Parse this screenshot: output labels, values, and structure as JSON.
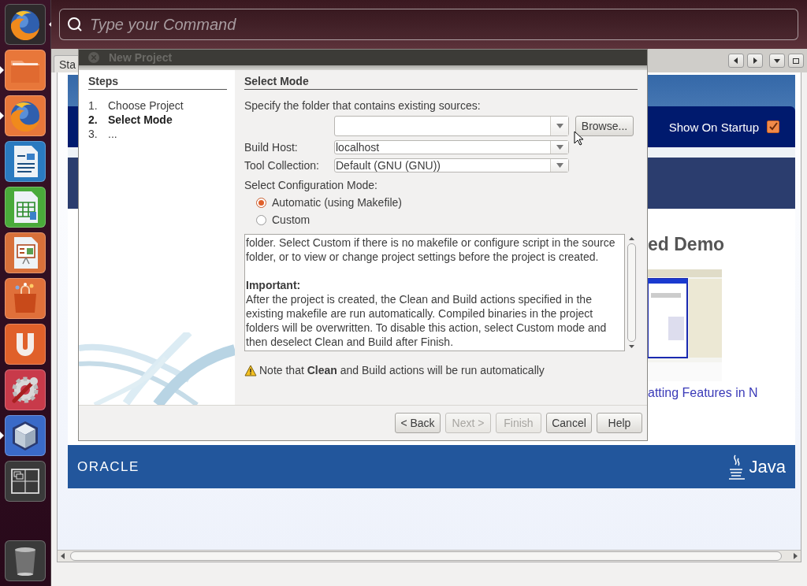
{
  "launcher": {
    "items": [
      {
        "kind": "firefox",
        "running": false,
        "selected": true
      },
      {
        "kind": "folder",
        "running": true,
        "selected": false
      },
      {
        "kind": "firefox",
        "running": true,
        "selected": false
      },
      {
        "kind": "writer",
        "running": false,
        "selected": false
      },
      {
        "kind": "calc",
        "running": false,
        "selected": false
      },
      {
        "kind": "impress",
        "running": false,
        "selected": false
      },
      {
        "kind": "store",
        "running": false,
        "selected": false
      },
      {
        "kind": "ubuntu_one",
        "running": false,
        "selected": false
      },
      {
        "kind": "settings",
        "running": false,
        "selected": false
      },
      {
        "kind": "cube",
        "running": true,
        "selected": false
      },
      {
        "kind": "workspaces",
        "running": false,
        "selected": false
      },
      {
        "kind": "trash",
        "running": false,
        "selected": false
      }
    ]
  },
  "dash": {
    "placeholder": "Type your Command"
  },
  "ide": {
    "tab": "Sta",
    "page": {
      "show_on_startup": {
        "label": "Show On Startup",
        "checked": true
      },
      "heading": "ed Demo",
      "link": "atting Features in N",
      "footer_left": "ORACLE",
      "footer_right": "Java"
    }
  },
  "dialog": {
    "title": "New Project",
    "steps_title": "Steps",
    "steps": [
      {
        "number": "1.",
        "label": "Choose Project",
        "selected": false
      },
      {
        "number": "2.",
        "label": "Select Mode",
        "selected": true
      },
      {
        "number": "3.",
        "label": "...",
        "selected": false
      }
    ],
    "panel_title": "Select Mode",
    "folder_label": {
      "text": "Specify the folder that contains existing sources:"
    },
    "browse": {
      "text": "Browse..."
    },
    "build_host": {
      "label": "Build Host:",
      "value": "localhost"
    },
    "tool_collection": {
      "label": "Tool Collection:",
      "value": "Default (GNU (GNU))"
    },
    "mode_label": {
      "text": "Select Configuration Mode:"
    },
    "modes": [
      {
        "label": "Automatic (using Makefile)",
        "selected": true
      },
      {
        "label": "Custom",
        "selected": false
      }
    ],
    "description": [
      {
        "kind": "paragraph",
        "text": "folder. Select Custom if there is no makefile or configure script in the source folder, or to view or change project settings before the project is created."
      },
      {
        "kind": "heading",
        "text": "Important:"
      },
      {
        "kind": "paragraph",
        "text": "After the project is created, the Clean and Build actions specified in the existing makefile are run automatically. Compiled binaries in the project folders will be overwritten. To disable this action, select Custom mode and then deselect Clean and Build after Finish."
      }
    ],
    "note": "Note that **Clean** and Build actions will be run automatically",
    "buttons": [
      {
        "label": "< Back",
        "disabled": false
      },
      {
        "label": "Next >",
        "disabled": true
      },
      {
        "label": "Finish",
        "disabled": true
      },
      {
        "label": "Cancel",
        "disabled": false
      },
      {
        "label": "Help",
        "disabled": false
      }
    ]
  }
}
